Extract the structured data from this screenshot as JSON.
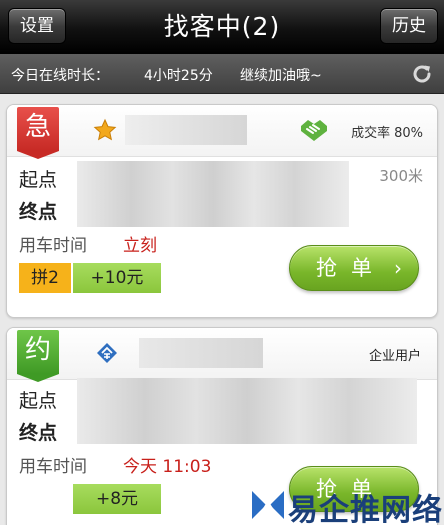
{
  "titlebar": {
    "settings_label": "设置",
    "title": "找客中(2)",
    "history_label": "历史"
  },
  "statusbar": {
    "online_label": "今日在线时长：",
    "online_time": "4小时25分",
    "cheer": "继续加油哦~"
  },
  "orders": [
    {
      "badge": "急",
      "badge_color": "#d63a35",
      "rate_label": "成交率",
      "rate_value": "80%",
      "start_label": "起点",
      "end_label": "终点",
      "distance": "300米",
      "use_time_label": "用车时间",
      "use_time_value": "立刻",
      "carpool_tag": "拼2",
      "bonus": "+10元",
      "grab_label": "抢单",
      "grab_chevron": "›"
    },
    {
      "badge": "约",
      "badge_color": "#4faa30",
      "user_type": "企业用户",
      "start_label": "起点",
      "end_label": "终点",
      "use_time_label": "用车时间",
      "use_time_value": "今天 11:03",
      "bonus": "+8元",
      "grab_label": "抢单"
    }
  ],
  "watermark": {
    "text": "易企推网络"
  },
  "colors": {
    "accent_green": "#79b62a",
    "urgent_red": "#d63a35",
    "highlight_red": "#c8201b",
    "tag_orange": "#f6b21a"
  }
}
